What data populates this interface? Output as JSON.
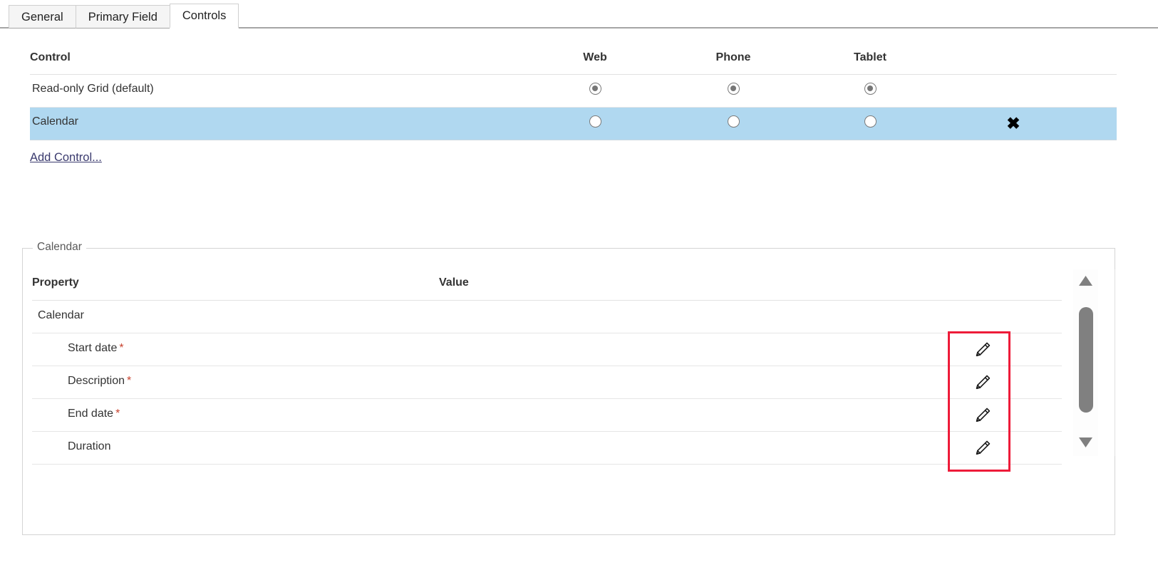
{
  "tabs": [
    {
      "label": "General",
      "active": false
    },
    {
      "label": "Primary Field",
      "active": false
    },
    {
      "label": "Controls",
      "active": true
    }
  ],
  "controls_table": {
    "headers": {
      "control": "Control",
      "web": "Web",
      "phone": "Phone",
      "tablet": "Tablet"
    },
    "rows": [
      {
        "name": "Read-only Grid (default)",
        "web_selected": true,
        "phone_selected": true,
        "tablet_selected": true,
        "highlighted": false,
        "deletable": false,
        "delete_glyph": ""
      },
      {
        "name": "Calendar",
        "web_selected": false,
        "phone_selected": false,
        "tablet_selected": false,
        "highlighted": true,
        "deletable": true,
        "delete_glyph": "✖"
      }
    ],
    "add_control_link": "Add Control..."
  },
  "properties_panel": {
    "legend": "Calendar",
    "headers": {
      "property": "Property",
      "value": "Value"
    },
    "rows": [
      {
        "name": "Calendar",
        "required": false,
        "indent": 0,
        "value": "",
        "has_edit": false,
        "edit_icon": "pencil-icon"
      },
      {
        "name": "Start date",
        "required": true,
        "indent": 1,
        "value": "",
        "has_edit": true,
        "edit_icon": "pencil-icon"
      },
      {
        "name": "Description",
        "required": true,
        "indent": 1,
        "value": "",
        "has_edit": true,
        "edit_icon": "pencil-icon"
      },
      {
        "name": "End date",
        "required": true,
        "indent": 1,
        "value": "",
        "has_edit": true,
        "edit_icon": "pencil-icon"
      },
      {
        "name": "Duration",
        "required": false,
        "indent": 1,
        "value": "",
        "has_edit": true,
        "edit_icon": "pencil-icon"
      }
    ],
    "required_marker": "*",
    "scrollbar": {
      "up_icon": "triangle-up-icon",
      "down_icon": "triangle-down-icon",
      "thumb": "scroll-thumb"
    }
  },
  "annotation": {
    "shape": "rectangle",
    "color": "#ee1b39",
    "target": "edit-pencil-column"
  },
  "colors": {
    "selected_row": "#b0d8f0",
    "annotation_red": "#ee1b39",
    "required_star": "#c8432f",
    "link": "#3a3a6e"
  }
}
